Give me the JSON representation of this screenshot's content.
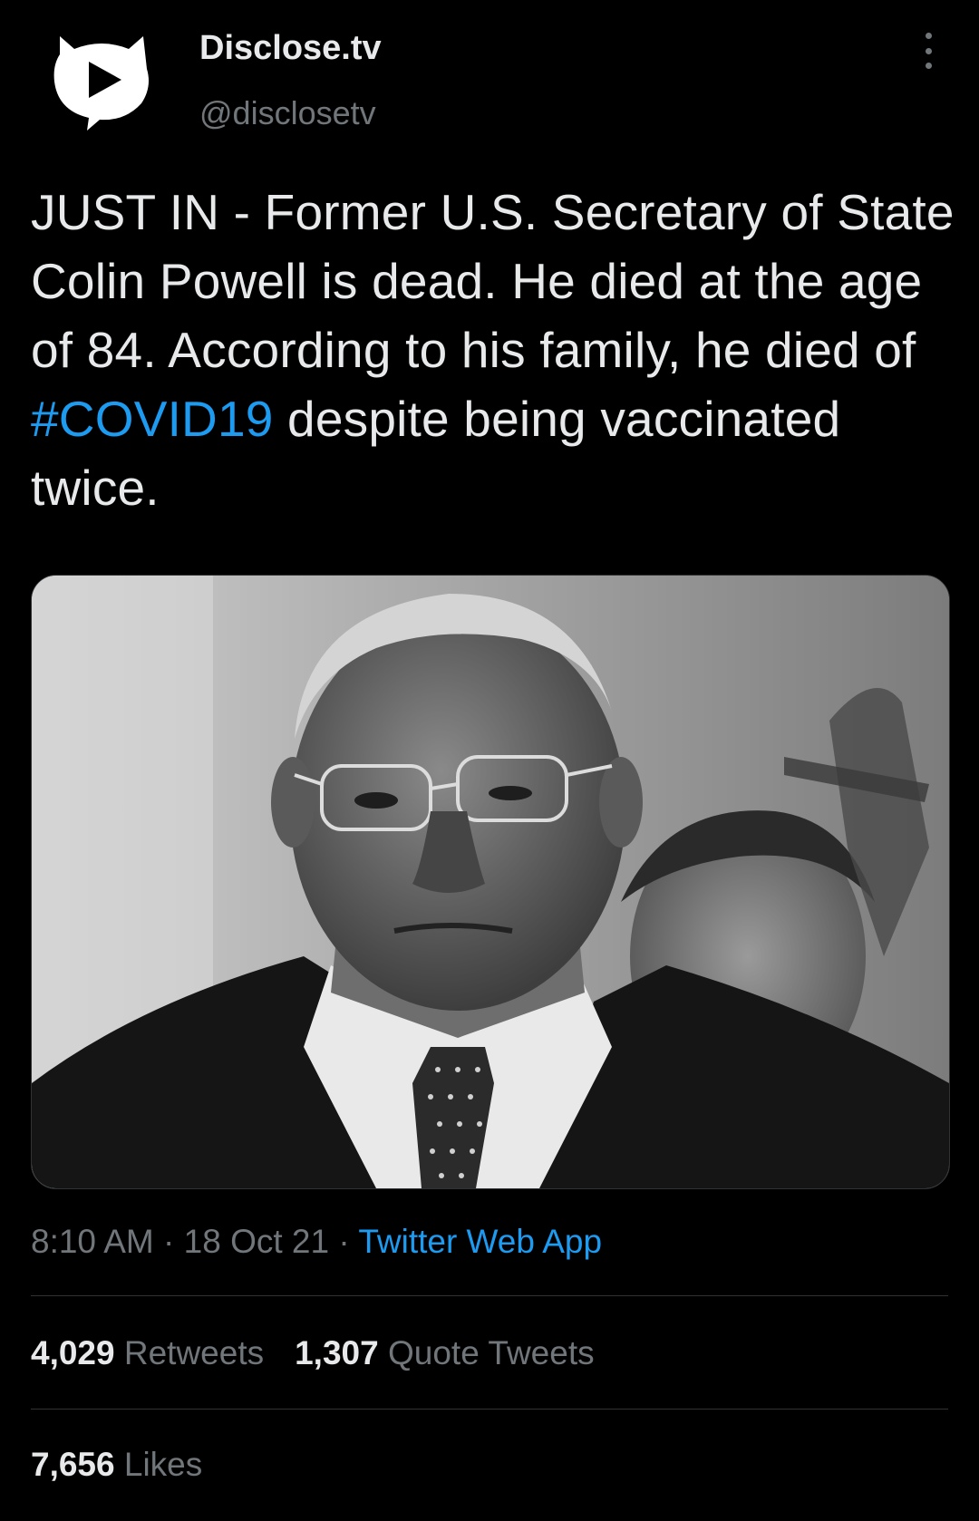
{
  "author": {
    "display_name": "Disclose.tv",
    "handle": "@disclosetv"
  },
  "tweet": {
    "text_before": "JUST IN - Former U.S. Secretary of State Colin Powell is dead. He died at the age of 84. According to his family, he died of ",
    "hashtag": "#COVID19",
    "text_after": " despite being vaccinated twice."
  },
  "meta": {
    "time": "8:10 AM",
    "date": "18 Oct 21",
    "separator": " · ",
    "source": "Twitter Web App"
  },
  "stats": {
    "retweets_count": "4,029",
    "retweets_label": "Retweets",
    "quotes_count": "1,307",
    "quotes_label": "Quote Tweets",
    "likes_count": "7,656",
    "likes_label": "Likes"
  },
  "icons": {
    "avatar": "disclosetv-logo-icon",
    "more": "more-options-icon"
  },
  "colors": {
    "background": "#000000",
    "text": "#e7e9ea",
    "secondary": "#71767b",
    "accent": "#1d9bf0",
    "divider": "#2f3336"
  }
}
